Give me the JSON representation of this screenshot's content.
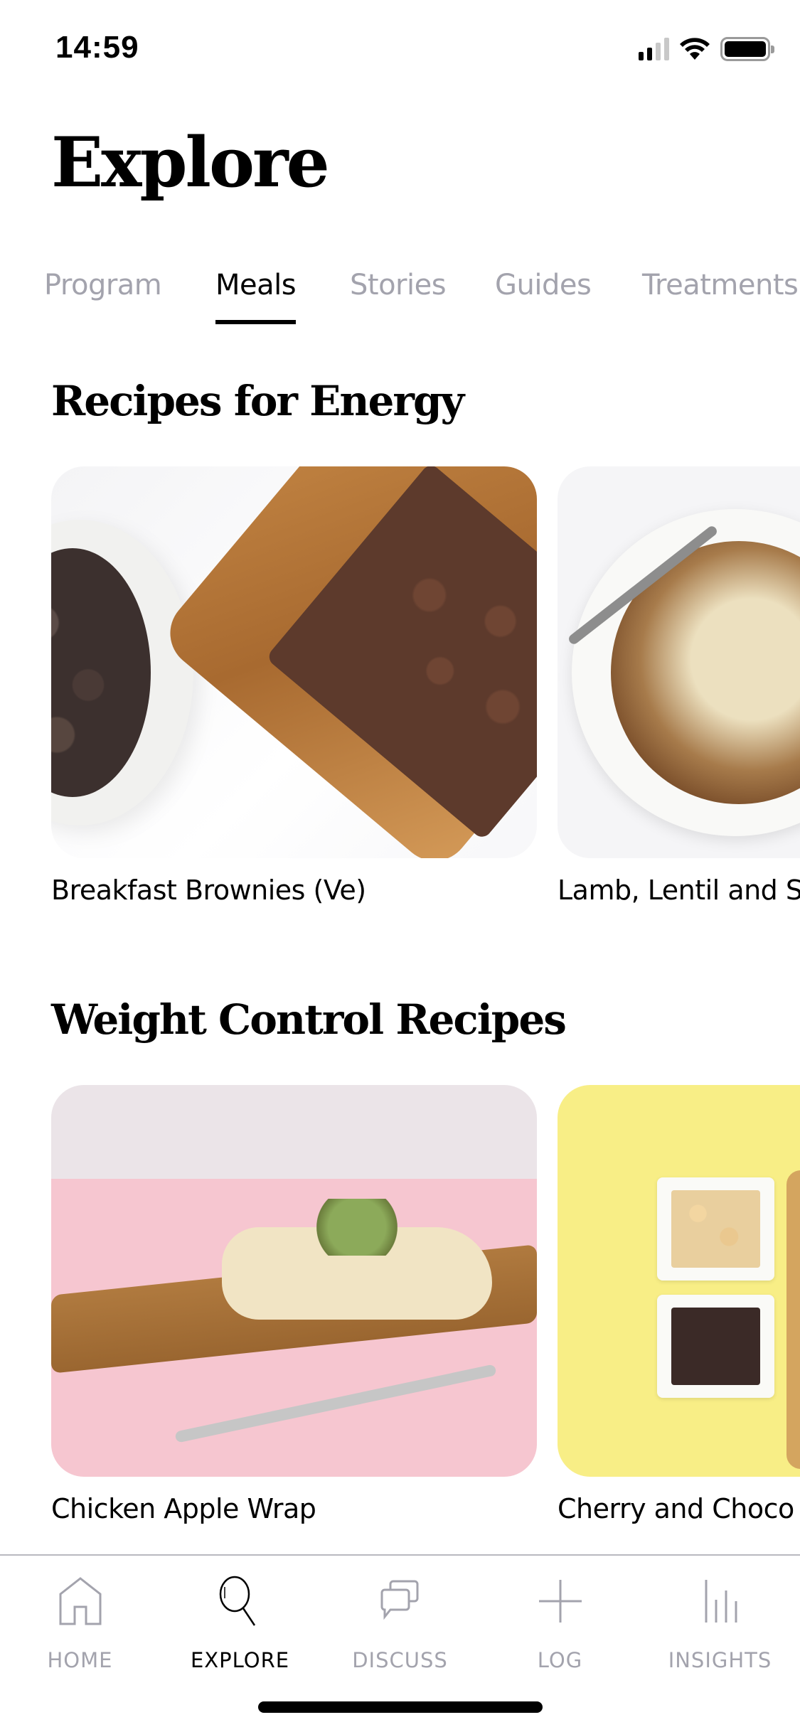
{
  "status_bar": {
    "time": "14:59",
    "icons": [
      "cellular-signal-icon",
      "wifi-icon",
      "battery-icon"
    ],
    "signal_bars_active": 2,
    "signal_bars_total": 4,
    "battery_level": 1.0
  },
  "header": {
    "title": "Explore"
  },
  "tabs": {
    "active_index": 1,
    "items": [
      {
        "label": "Program"
      },
      {
        "label": "Meals"
      },
      {
        "label": "Stories"
      },
      {
        "label": "Guides"
      },
      {
        "label": "Treatments"
      }
    ]
  },
  "sections": [
    {
      "title": "Recipes for Energy",
      "recipes": [
        {
          "title": "Breakfast Brownies (Ve)",
          "image": "brownies-photo"
        },
        {
          "title": "Lamb, Lentil and S",
          "image": "lamb-lentil-bake-photo"
        }
      ]
    },
    {
      "title": "Weight Control Recipes",
      "recipes": [
        {
          "title": "Chicken Apple Wrap",
          "image": "chicken-wrap-photo"
        },
        {
          "title": "Cherry and Choco",
          "image": "cherry-chocolate-photo"
        }
      ]
    }
  ],
  "bottom_nav": {
    "active_index": 1,
    "items": [
      {
        "label": "HOME",
        "icon": "home-icon"
      },
      {
        "label": "EXPLORE",
        "icon": "search-icon"
      },
      {
        "label": "DISCUSS",
        "icon": "chat-bubbles-icon"
      },
      {
        "label": "LOG",
        "icon": "plus-icon"
      },
      {
        "label": "INSIGHTS",
        "icon": "bar-chart-icon"
      }
    ]
  },
  "colors": {
    "active": "#000000",
    "inactive": "#a3a3ad",
    "background": "#ffffff"
  }
}
